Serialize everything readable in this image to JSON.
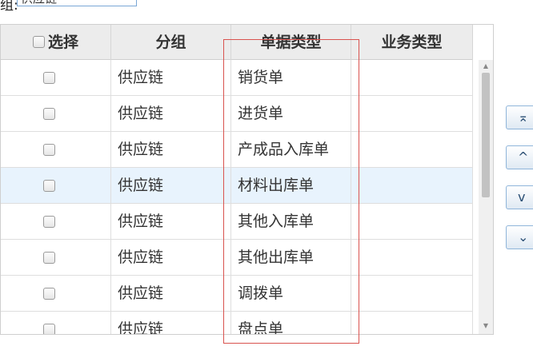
{
  "filter": {
    "label": "组:",
    "value": "供应链"
  },
  "table": {
    "headers": {
      "select": "选择",
      "group": "分组",
      "doc_type": "单据类型",
      "biz_type": "业务类型"
    },
    "rows": [
      {
        "group": "供应链",
        "doc_type": "销货单",
        "biz_type": ""
      },
      {
        "group": "供应链",
        "doc_type": "进货单",
        "biz_type": ""
      },
      {
        "group": "供应链",
        "doc_type": "产成品入库单",
        "biz_type": ""
      },
      {
        "group": "供应链",
        "doc_type": "材料出库单",
        "biz_type": ""
      },
      {
        "group": "供应链",
        "doc_type": "其他入库单",
        "biz_type": ""
      },
      {
        "group": "供应链",
        "doc_type": "其他出库单",
        "biz_type": ""
      },
      {
        "group": "供应链",
        "doc_type": "调拨单",
        "biz_type": ""
      },
      {
        "group": "供应链",
        "doc_type": "盘点单",
        "biz_type": ""
      }
    ],
    "selected_row": 3
  },
  "scrollbar": {
    "up_icon": "triangle-up-icon",
    "down_icon": "triangle-down-icon"
  },
  "move_buttons": [
    {
      "icon": "move-to-top-icon",
      "glyph": "⌅"
    },
    {
      "icon": "move-up-icon",
      "glyph": "^"
    },
    {
      "icon": "move-down-icon",
      "glyph": "v"
    },
    {
      "icon": "move-to-bottom-icon",
      "glyph": "⌄"
    }
  ],
  "colors": {
    "highlight_row": "#e8f3fd",
    "annotation_box": "#d9534f",
    "header_bg": "#ececec"
  }
}
